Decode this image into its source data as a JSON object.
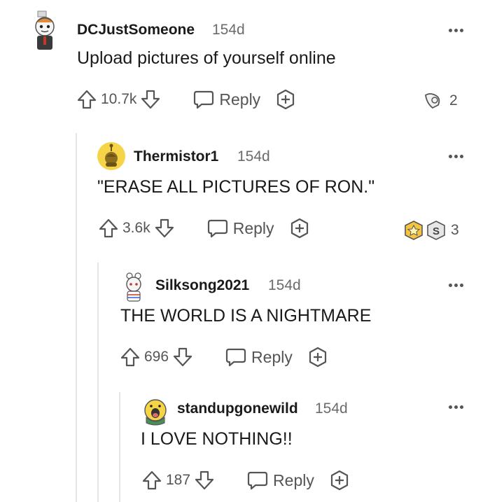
{
  "comments": [
    {
      "username": "DCJustSomeone",
      "time": "154d",
      "body": "Upload pictures of yourself online",
      "score": "10.7k",
      "reply_label": "Reply",
      "award_count": "2",
      "avatar_icon": "snoo-avatar-icon",
      "award_icon": "silver-award-icon"
    },
    {
      "username": "Thermistor1",
      "time": "154d",
      "body": "\"ERASE ALL PICTURES OF RON.\"",
      "score": "3.6k",
      "reply_label": "Reply",
      "award_count": "3",
      "avatar_icon": "snoo-avatar-icon",
      "award_icon": "gold-award-icon"
    },
    {
      "username": "Silksong2021",
      "time": "154d",
      "body": "THE WORLD IS A NIGHTMARE",
      "score": "696",
      "reply_label": "Reply",
      "avatar_icon": "snoo-avatar-icon"
    },
    {
      "username": "standupgonewild",
      "time": "154d",
      "body": "I LOVE NOTHING!!",
      "score": "187",
      "reply_label": "Reply",
      "avatar_icon": "snoo-avatar-icon"
    }
  ],
  "colors": {
    "text": "#1a1a1b",
    "muted": "#6b6b6b",
    "thread_line": "#e5e5e5"
  }
}
